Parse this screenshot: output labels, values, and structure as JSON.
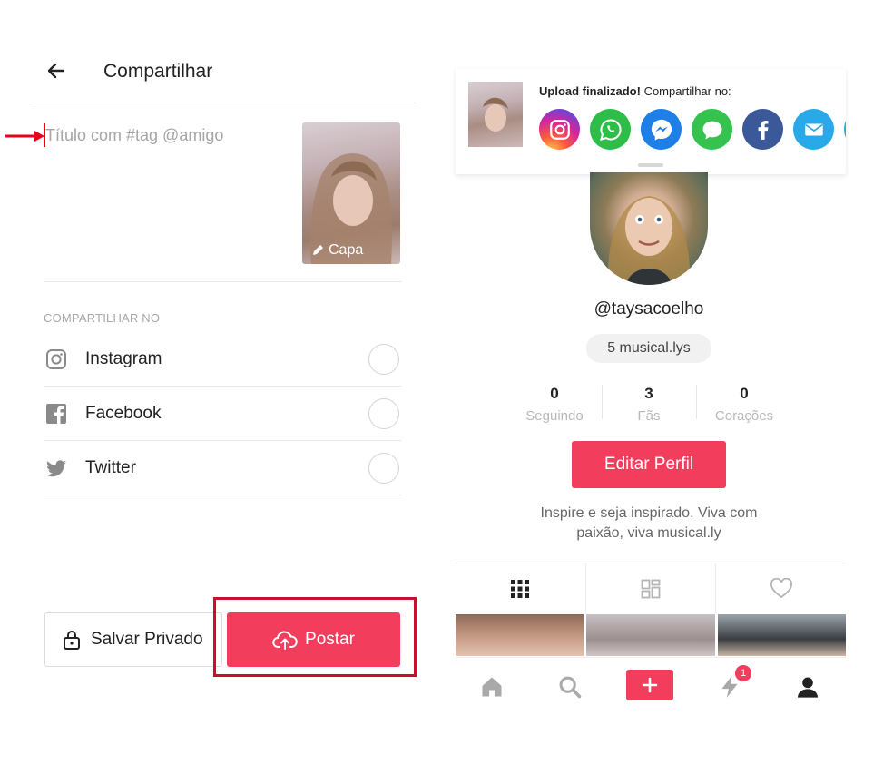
{
  "share_screen": {
    "title": "Compartilhar",
    "caption_placeholder": "Título com #tag @amigo",
    "cover_label": "Capa",
    "share_heading": "COMPARTILHAR NO",
    "share_options": [
      {
        "label": "Instagram",
        "icon": "instagram-icon",
        "selected": false
      },
      {
        "label": "Facebook",
        "icon": "facebook-icon",
        "selected": false
      },
      {
        "label": "Twitter",
        "icon": "twitter-icon",
        "selected": false
      }
    ],
    "save_private_label": "Salvar Privado",
    "post_label": "Postar"
  },
  "profile_screen": {
    "upload_notice": {
      "bold": "Upload finalizado!",
      "rest": " Compartilhar no:",
      "apps": [
        "instagram",
        "whatsapp",
        "messenger",
        "messages",
        "facebook",
        "email"
      ]
    },
    "username": "@taysacoelho",
    "musical_count": "5 musical.lys",
    "stats": [
      {
        "value": "0",
        "label": "Seguindo"
      },
      {
        "value": "3",
        "label": "Fãs"
      },
      {
        "value": "0",
        "label": "Corações"
      }
    ],
    "edit_profile_label": "Editar Perfil",
    "bio_line1": "Inspire e seja inspirado. Viva com",
    "bio_line2": "paixão, viva musical.ly",
    "notification_badge": "1"
  },
  "colors": {
    "accent": "#f23d5d",
    "highlight_frame": "#c8102e",
    "annotation_arrow": "#e8001c"
  }
}
